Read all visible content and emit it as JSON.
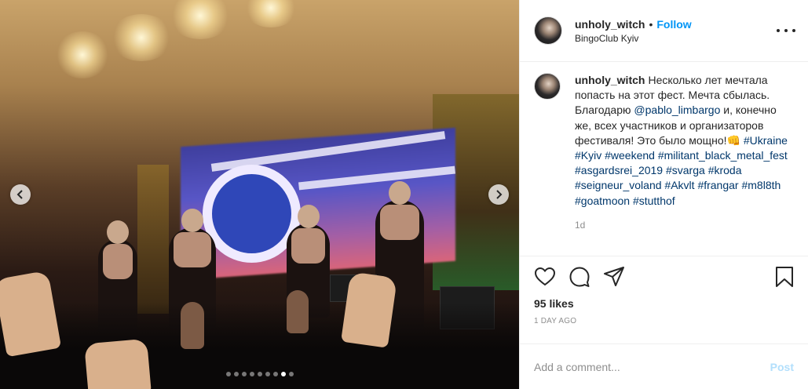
{
  "post": {
    "author": "unholy_witch",
    "separator": "•",
    "follow_label": "Follow",
    "location": "BingoClub Kyiv"
  },
  "caption": {
    "username": "unholy_witch",
    "text_1": "Несколько лет мечтала попасть на этот фест. Мечта сбылась. Благодарю ",
    "mention": "@pablo_limbargo",
    "text_2": " и, конечно же, всех участников и организаторов фестиваля! Это было мощно!",
    "emoji": "👊",
    "hashtags": [
      "#Ukraine",
      "#Kyiv",
      "#weekend",
      "#militant_black_metal_fest",
      "#asgardsrei_2019",
      "#svarga",
      "#kroda",
      "#seigneur_voland",
      "#Akvlt",
      "#frangar",
      "#m8l8th",
      "#goatmoon",
      "#stutthof"
    ],
    "age": "1d"
  },
  "engagement": {
    "likes": "95 likes",
    "date": "1 DAY AGO"
  },
  "comment_box": {
    "placeholder": "Add a comment...",
    "post_label": "Post"
  },
  "carousel": {
    "total": 9,
    "active_index": 7
  },
  "icons": {
    "like": "heart-icon",
    "comment": "comment-icon",
    "share": "share-icon",
    "save": "bookmark-icon",
    "more": "more-options-icon",
    "prev": "chevron-left-icon",
    "next": "chevron-right-icon"
  },
  "colors": {
    "follow": "#0095f6",
    "link": "#00376b",
    "post_disabled": "#b2dffc",
    "muted": "#8e8e8e"
  }
}
